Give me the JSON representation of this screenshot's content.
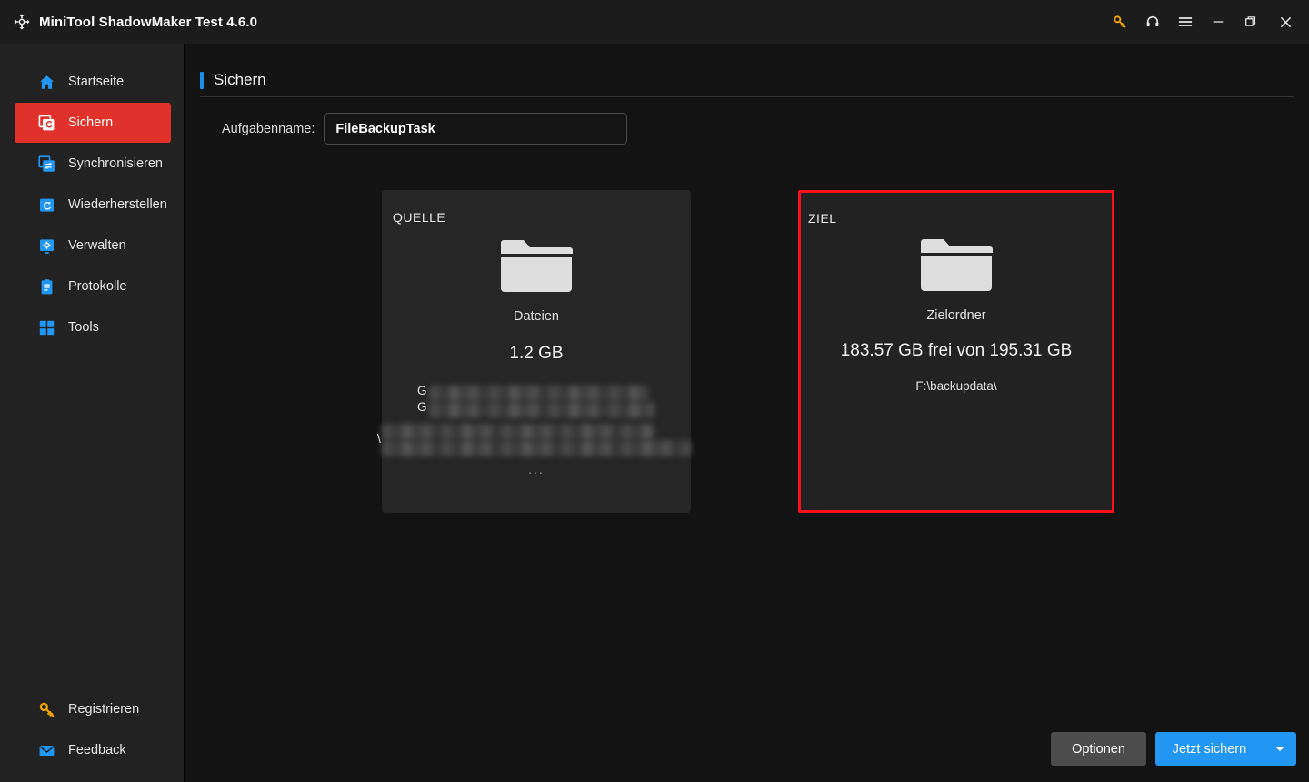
{
  "titlebar": {
    "app_title": "MiniTool ShadowMaker Test 4.6.0",
    "logo_icon": "shadowmaker-logo-icon",
    "actions": [
      {
        "icon": "key-icon",
        "name": "register-key-icon",
        "color": "#f0a500"
      },
      {
        "icon": "headset-icon",
        "name": "support-headset-icon",
        "color": "#e8e8e8"
      },
      {
        "icon": "hamburger-menu-icon",
        "name": "menu-icon",
        "color": "#e8e8e8"
      },
      {
        "icon": "minimize-icon",
        "name": "minimize-button",
        "color": "#e8e8e8"
      },
      {
        "icon": "restore-icon",
        "name": "maximize-restore-button",
        "color": "#e8e8e8"
      },
      {
        "icon": "close-icon",
        "name": "close-button",
        "color": "#e8e8e8"
      }
    ]
  },
  "sidebar": {
    "active_color": "#e0322a",
    "icon_color": "#2196f3",
    "items": [
      {
        "label": "Startseite",
        "icon": "home-icon",
        "active": false
      },
      {
        "label": "Sichern",
        "icon": "backup-icon",
        "active": true
      },
      {
        "label": "Synchronisieren",
        "icon": "sync-icon",
        "active": false
      },
      {
        "label": "Wiederherstellen",
        "icon": "restore-clock-icon",
        "active": false
      },
      {
        "label": "Verwalten",
        "icon": "manage-gear-monitor-icon",
        "active": false
      },
      {
        "label": "Protokolle",
        "icon": "logs-clipboard-icon",
        "active": false
      },
      {
        "label": "Tools",
        "icon": "tools-grid-icon",
        "active": false
      }
    ],
    "bottom_items": [
      {
        "label": "Registrieren",
        "icon": "key-icon",
        "color": "#f0a500"
      },
      {
        "label": "Feedback",
        "icon": "envelope-icon",
        "color": "#2196f3"
      }
    ]
  },
  "page": {
    "title": "Sichern",
    "accent_color": "#1e8fe8",
    "task_name_label": "Aufgabenname:",
    "task_name_value": "FileBackupTask",
    "task_name_placeholder": "Aufgabenname"
  },
  "source_card": {
    "kicker": "QUELLE",
    "icon": "folder-icon",
    "type_label": "Dateien",
    "size": "1.2 GB",
    "path_prefixes": [
      "G",
      "G",
      "\\"
    ],
    "paths_redacted": true,
    "more_indicator": "..."
  },
  "arrow": {
    "icon": "triple-chevron-right-icon"
  },
  "target_card": {
    "kicker": "ZIEL",
    "icon": "folder-icon",
    "type_label": "Zielordner",
    "capacity": "183.57 GB frei von 195.31 GB",
    "path": "F:\\backupdata\\",
    "highlight_color": "#fc0d1b"
  },
  "footer": {
    "options_label": "Optionen",
    "backup_now_label": "Jetzt sichern",
    "backup_now_color": "#2196f3",
    "dropdown_icon": "caret-down-icon"
  }
}
